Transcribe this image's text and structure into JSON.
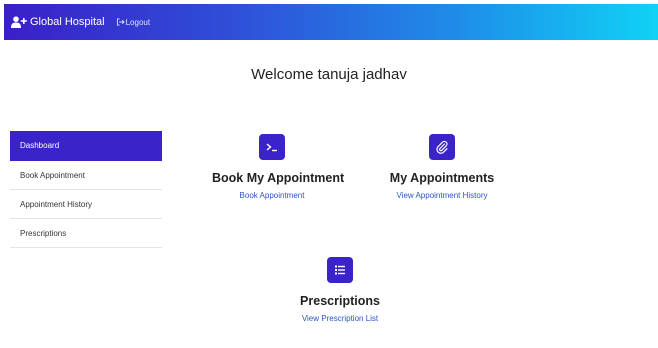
{
  "navbar": {
    "brand": "Global Hospital",
    "logout": "Logout",
    "brand_icon": "user-plus-icon",
    "logout_icon": "sign-out-icon"
  },
  "welcome": "Welcome  tanuja jadhav",
  "sidebar": {
    "items": [
      {
        "label": "Dashboard",
        "active": true
      },
      {
        "label": "Book Appointment"
      },
      {
        "label": "Appointment History"
      },
      {
        "label": "Prescriptions"
      }
    ]
  },
  "cards": {
    "book": {
      "title": "Book My Appointment",
      "link": "Book Appointment",
      "icon": "terminal-icon"
    },
    "appointments": {
      "title": "My Appointments",
      "link": "View Appointment History",
      "icon": "paperclip-icon"
    },
    "prescriptions": {
      "title": "Prescriptions",
      "link": "View Prescription List",
      "icon": "list-icon"
    }
  },
  "colors": {
    "accent": "#3a23c9",
    "link": "#2c56c4",
    "nav_start": "#3a1fc8",
    "nav_end": "#10d2f6"
  }
}
